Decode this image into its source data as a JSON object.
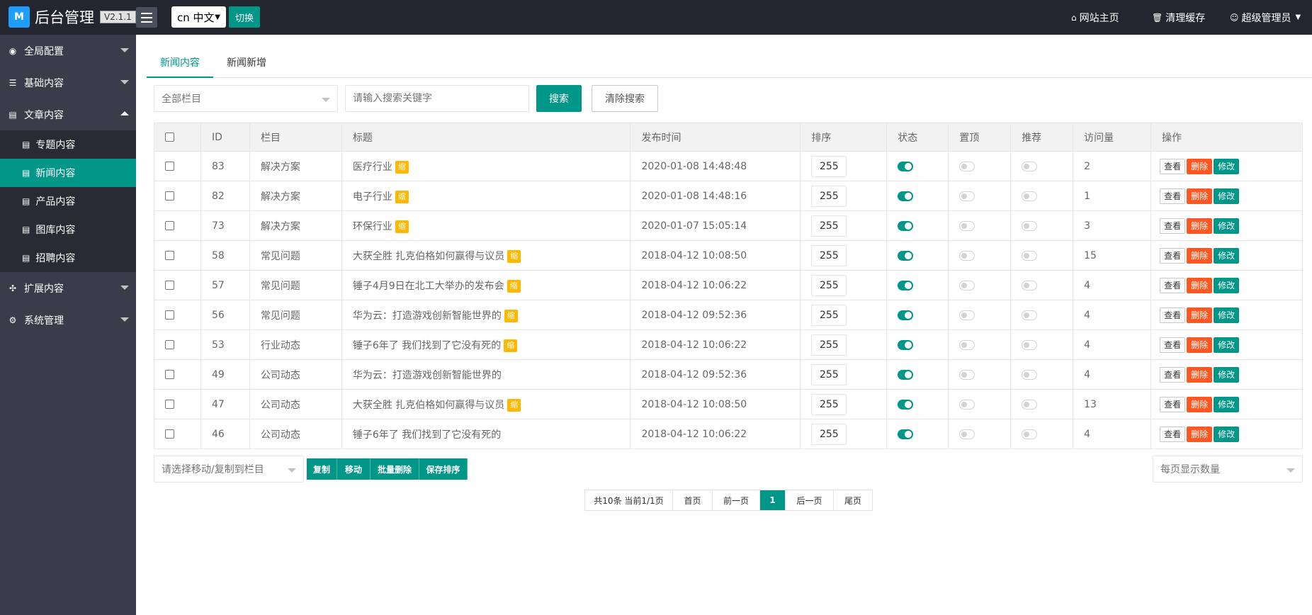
{
  "header": {
    "logo_mark": "M",
    "title": "后台管理",
    "version": "V2.1.1",
    "lang_selected": "cn 中文",
    "switch_label": "切换",
    "site_home": "网站主页",
    "clear_cache": "清理缓存",
    "admin_name": "超级管理员"
  },
  "sidebar": {
    "items": [
      {
        "label": "全局配置",
        "icon": "globe-icon"
      },
      {
        "label": "基础内容",
        "icon": "sliders-icon"
      },
      {
        "label": "文章内容",
        "icon": "file-icon"
      },
      {
        "label": "扩展内容",
        "icon": "expand-icon"
      },
      {
        "label": "系统管理",
        "icon": "gear-icon"
      }
    ],
    "sub_items": [
      {
        "label": "专题内容"
      },
      {
        "label": "新闻内容"
      },
      {
        "label": "产品内容"
      },
      {
        "label": "图库内容"
      },
      {
        "label": "招聘内容"
      }
    ]
  },
  "tabs": [
    "新闻内容",
    "新闻新增"
  ],
  "filter": {
    "column_placeholder": "全部栏目",
    "search_placeholder": "请输入搜索关键字",
    "search_label": "搜索",
    "clear_label": "清除搜索"
  },
  "table": {
    "headers": [
      "ID",
      "栏目",
      "标题",
      "发布时间",
      "排序",
      "状态",
      "置顶",
      "推荐",
      "访问量",
      "操作"
    ],
    "thumb_tag": "缩",
    "ops": {
      "view": "查看",
      "delete": "删除",
      "edit": "修改"
    },
    "rows": [
      {
        "id": "83",
        "column": "解决方案",
        "title": "医疗行业",
        "thumb": true,
        "date": "2020-01-08 14:48:48",
        "sort": "255",
        "status": true,
        "top": false,
        "rec": false,
        "views": "2"
      },
      {
        "id": "82",
        "column": "解决方案",
        "title": "电子行业",
        "thumb": true,
        "date": "2020-01-08 14:48:16",
        "sort": "255",
        "status": true,
        "top": false,
        "rec": false,
        "views": "1"
      },
      {
        "id": "73",
        "column": "解决方案",
        "title": "环保行业",
        "thumb": true,
        "date": "2020-01-07 15:05:14",
        "sort": "255",
        "status": true,
        "top": false,
        "rec": false,
        "views": "3"
      },
      {
        "id": "58",
        "column": "常见问题",
        "title": "大获全胜 扎克伯格如何赢得与议员",
        "thumb": true,
        "date": "2018-04-12 10:08:50",
        "sort": "255",
        "status": true,
        "top": false,
        "rec": false,
        "views": "15"
      },
      {
        "id": "57",
        "column": "常见问题",
        "title": "锤子4月9日在北工大举办的发布会",
        "thumb": true,
        "date": "2018-04-12 10:06:22",
        "sort": "255",
        "status": true,
        "top": false,
        "rec": false,
        "views": "4"
      },
      {
        "id": "56",
        "column": "常见问题",
        "title": "华为云：打造游戏创新智能世界的",
        "thumb": true,
        "date": "2018-04-12 09:52:36",
        "sort": "255",
        "status": true,
        "top": false,
        "rec": false,
        "views": "4"
      },
      {
        "id": "53",
        "column": "行业动态",
        "title": "锤子6年了 我们找到了它没有死的",
        "thumb": true,
        "date": "2018-04-12 10:06:22",
        "sort": "255",
        "status": true,
        "top": false,
        "rec": false,
        "views": "4"
      },
      {
        "id": "49",
        "column": "公司动态",
        "title": "华为云：打造游戏创新智能世界的",
        "thumb": false,
        "date": "2018-04-12 09:52:36",
        "sort": "255",
        "status": true,
        "top": false,
        "rec": false,
        "views": "4"
      },
      {
        "id": "47",
        "column": "公司动态",
        "title": "大获全胜 扎克伯格如何赢得与议员",
        "thumb": true,
        "date": "2018-04-12 10:08:50",
        "sort": "255",
        "status": true,
        "top": false,
        "rec": false,
        "views": "13"
      },
      {
        "id": "46",
        "column": "公司动态",
        "title": "锤子6年了 我们找到了它没有死的",
        "thumb": false,
        "date": "2018-04-12 10:06:22",
        "sort": "255",
        "status": true,
        "top": false,
        "rec": false,
        "views": "4"
      }
    ]
  },
  "batch": {
    "move_placeholder": "请选择移动/复制到栏目",
    "copy": "复制",
    "move": "移动",
    "batch_delete": "批量删除",
    "save_sort": "保存排序",
    "page_size_placeholder": "每页显示数量"
  },
  "pager": {
    "info": "共10条 当前1/1页",
    "first": "首页",
    "prev": "前一页",
    "current": "1",
    "next": "后一页",
    "last": "尾页"
  },
  "colors": {
    "accent": "#009688",
    "danger": "#ff5722",
    "warn": "#ffb800",
    "sidebar_bg": "#393d49",
    "header_bg": "#23262e"
  }
}
